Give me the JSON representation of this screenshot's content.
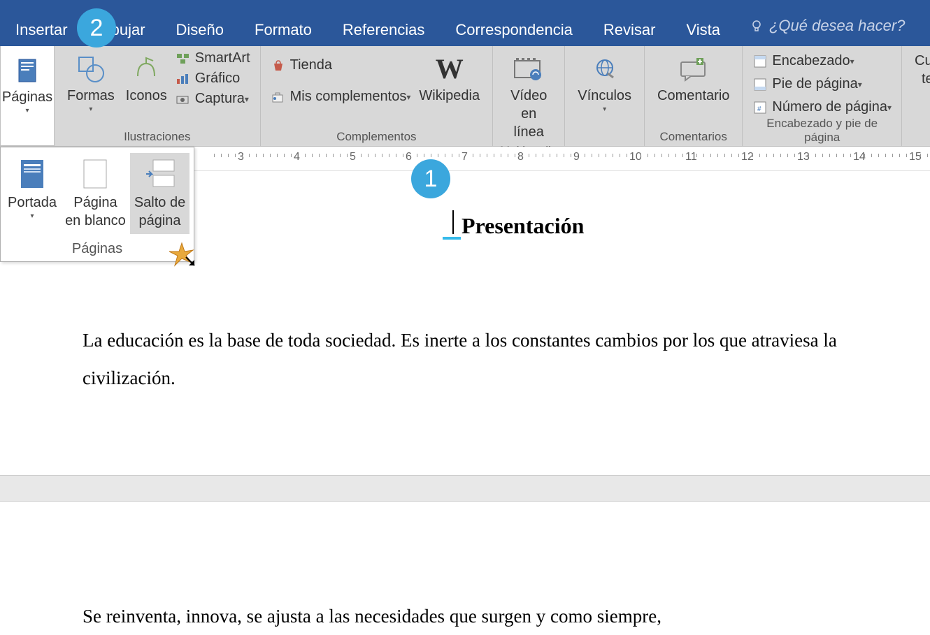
{
  "tabs": {
    "insertar": "Insertar",
    "dibujar": "bujar",
    "diseno": "Diseño",
    "formato": "Formato",
    "referencias": "Referencias",
    "correspondencia": "Correspondencia",
    "revisar": "Revisar",
    "vista": "Vista",
    "tellme": "¿Qué desea hacer?"
  },
  "ribbon": {
    "paginas_label": "Páginas",
    "ilustraciones": {
      "formas": "Formas",
      "iconos": "Iconos",
      "smartart": "SmartArt",
      "grafico": "Gráfico",
      "captura": "Captura",
      "group": "Ilustraciones"
    },
    "complementos": {
      "tienda": "Tienda",
      "mis": "Mis complementos",
      "wikipedia": "Wikipedia",
      "group": "Complementos"
    },
    "multimedia": {
      "video_l1": "Vídeo",
      "video_l2": "en línea",
      "group": "Multimedia"
    },
    "vinculos": "Vínculos",
    "comentarios": {
      "btn": "Comentario",
      "group": "Comentarios"
    },
    "headerfooter": {
      "enc": "Encabezado",
      "pie": "Pie de página",
      "num": "Número de página",
      "group": "Encabezado y pie de página"
    },
    "cuadro_l1": "Cua",
    "cuadro_l2": "te"
  },
  "pages_dropdown": {
    "portada": "Portada",
    "blanco_l1": "Página",
    "blanco_l2": "en blanco",
    "salto_l1": "Salto de",
    "salto_l2": "página",
    "group": "Páginas"
  },
  "ruler": [
    "3",
    "4",
    "5",
    "6",
    "7",
    "8",
    "9",
    "10",
    "11",
    "12",
    "13",
    "14",
    "15"
  ],
  "doc": {
    "title": "Presentación",
    "p1": "La educación es la base de toda sociedad. Es inerte a los constantes cambios por los que atraviesa la civilización.",
    "p2": "Se reinventa, innova, se ajusta a las necesidades que surgen y como siempre,"
  },
  "badges": {
    "one": "1",
    "two": "2"
  }
}
